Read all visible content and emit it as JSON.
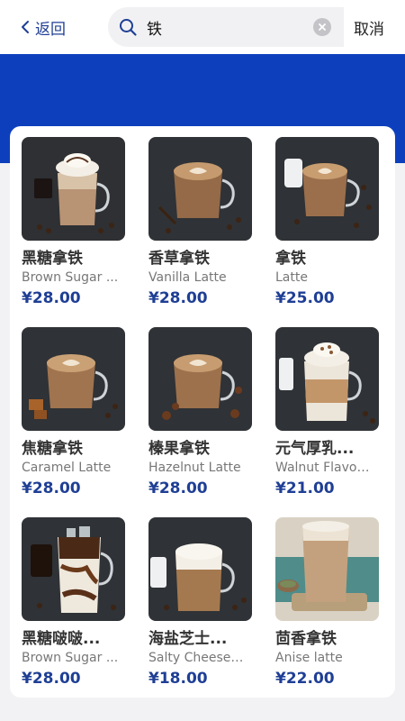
{
  "header": {
    "back_label": "返回",
    "search_query": "铁",
    "cancel_label": "取消"
  },
  "colors": {
    "brand_blue": "#0d3fbd",
    "price_blue": "#1f3f95"
  },
  "products": [
    {
      "name_cn": "黑糖拿铁",
      "name_en": "Brown Sugar ...",
      "price": "¥28.00"
    },
    {
      "name_cn": "香草拿铁",
      "name_en": "Vanilla Latte",
      "price": "¥28.00"
    },
    {
      "name_cn": "拿铁",
      "name_en": "Latte",
      "price": "¥25.00"
    },
    {
      "name_cn": "焦糖拿铁",
      "name_en": "Caramel Latte",
      "price": "¥28.00"
    },
    {
      "name_cn": "榛果拿铁",
      "name_en": "Hazelnut Latte",
      "price": "¥28.00"
    },
    {
      "name_cn": "元气厚乳...",
      "name_en": "Walnut Flavor...",
      "price": "¥21.00"
    },
    {
      "name_cn": "黑糖啵啵...",
      "name_en": "Brown Sugar ...",
      "price": "¥28.00"
    },
    {
      "name_cn": "海盐芝士...",
      "name_en": "Salty Cheese ...",
      "price": "¥18.00"
    },
    {
      "name_cn": "茴香拿铁",
      "name_en": "Anise latte",
      "price": "¥22.00"
    }
  ]
}
